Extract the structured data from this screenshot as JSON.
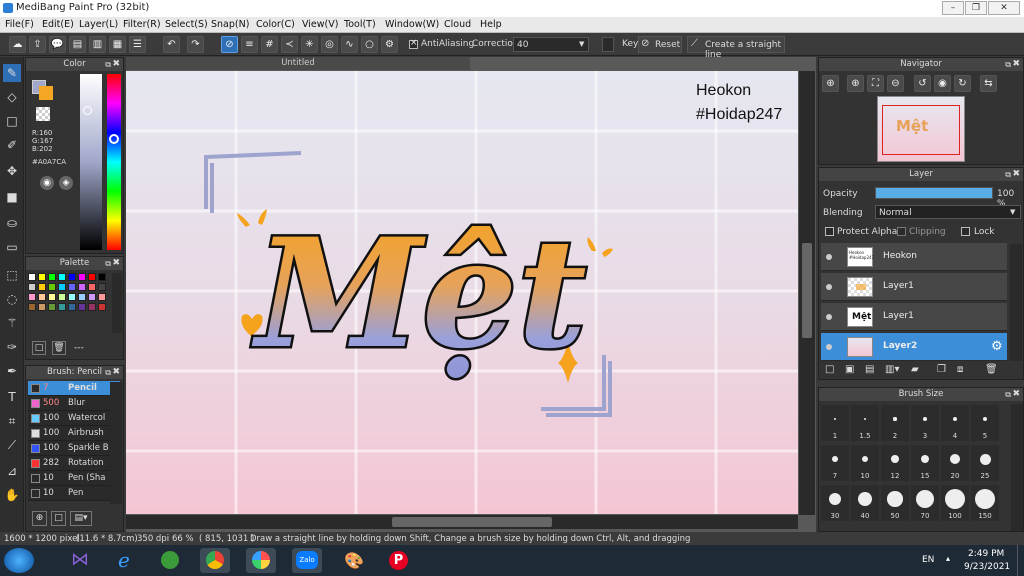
{
  "window": {
    "title": "MediBang Paint Pro (32bit)"
  },
  "menu": [
    "File(F)",
    "Edit(E)",
    "Layer(L)",
    "Filter(R)",
    "Select(S)",
    "Snap(N)",
    "Color(C)",
    "View(V)",
    "Tool(T)",
    "Window(W)",
    "Cloud",
    "Help"
  ],
  "toolbar": {
    "antialiasing_label": "AntiAliasing",
    "correction_label": "Correction",
    "correction_value": "40",
    "key_label": "Key",
    "reset_label": "Reset",
    "straight_line_label": "Create a straight line"
  },
  "canvas": {
    "tab_title": "Untitled",
    "watermark_line1": "Heokon",
    "watermark_line2": "#Hoidap247",
    "artwork_text": "Mệt"
  },
  "color_panel": {
    "title": "Color",
    "r": "R:160",
    "g": "G:167",
    "b": "B:202",
    "hex": "#A0A7CA",
    "main_color": "#a0a7ca",
    "sub_color": "#f5a623"
  },
  "palette_panel": {
    "title": "Palette",
    "footer_text": "---",
    "colors": [
      "#ffffff",
      "#ffff00",
      "#00ff00",
      "#00ffff",
      "#0000ff",
      "#ff00ff",
      "#ff0000",
      "#000000",
      "#cccccc",
      "#ffcc00",
      "#66cc00",
      "#00ccff",
      "#6666ff",
      "#cc66ff",
      "#ff6666",
      "#444444",
      "#ff99cc",
      "#ffcc99",
      "#ffff99",
      "#ccff99",
      "#99ffff",
      "#99ccff",
      "#cc99ff",
      "#ff9999",
      "#996633",
      "#cc9966",
      "#669933",
      "#339999",
      "#336699",
      "#663399",
      "#993366",
      "#cc3333"
    ]
  },
  "brush_panel": {
    "title": "Brush: Pencil",
    "brushes": [
      {
        "size": "7",
        "name": "Pencil",
        "color": "#2a2a2a"
      },
      {
        "size": "500",
        "name": "Blur",
        "color": "#ee66cc"
      },
      {
        "size": "100",
        "name": "Watercol",
        "color": "#66ccff"
      },
      {
        "size": "100",
        "name": "Airbrush",
        "color": "#dddddd"
      },
      {
        "size": "100",
        "name": "Sparkle B",
        "color": "#3355ff"
      },
      {
        "size": "282",
        "name": "Rotation",
        "color": "#ff3333"
      },
      {
        "size": "10",
        "name": "Pen (Sha",
        "color": "#2a2a2a"
      },
      {
        "size": "10",
        "name": "Pen",
        "color": "#2a2a2a"
      }
    ]
  },
  "navigator": {
    "title": "Navigator",
    "thumb_text": "Mệt"
  },
  "layer_panel": {
    "title": "Layer",
    "opacity_label": "Opacity",
    "opacity_value": "100 %",
    "opacity_fraction": 1.0,
    "blending_label": "Blending",
    "blending_value": "Normal",
    "protect_alpha_label": "Protect Alpha",
    "clipping_label": "Clipping",
    "lock_label": "Lock",
    "layers": [
      {
        "name": "Heokon",
        "thumb_text": "Heokon #Hoidap247"
      },
      {
        "name": "Layer1",
        "thumb_text": ""
      },
      {
        "name": "Layer1",
        "thumb_text": "Mệt"
      },
      {
        "name": "Layer2",
        "thumb_text": ""
      }
    ]
  },
  "brush_size_panel": {
    "title": "Brush Size",
    "sizes": [
      "1",
      "1.5",
      "2",
      "3",
      "4",
      "5",
      "7",
      "10",
      "12",
      "15",
      "20",
      "25",
      "30",
      "40",
      "50",
      "70",
      "100",
      "150"
    ]
  },
  "statusbar": {
    "dimensions": "1600 * 1200 pixel",
    "cm": "(11.6 * 8.7cm)",
    "dpi": "350 dpi",
    "zoom": "66 %",
    "coords": "( 815, 1031 )",
    "hint": "Draw a straight line by holding down Shift, Change a brush size by holding down Ctrl, Alt, and dragging"
  },
  "taskbar": {
    "lang": "EN",
    "time": "2:49 PM",
    "date": "9/23/2021",
    "zalo_label": "Zalo"
  }
}
